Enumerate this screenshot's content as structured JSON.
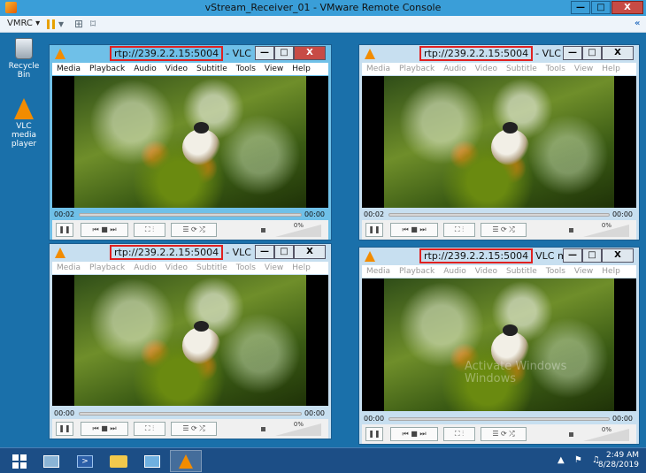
{
  "window": {
    "title": "vStream_Receiver_01 - VMware Remote Console",
    "min": "—",
    "max": "□",
    "close": "X"
  },
  "toolbar": {
    "menu": "VMRC ▾",
    "collapse": "«"
  },
  "desktop_icons": [
    {
      "label": "Recycle Bin"
    },
    {
      "label": "VLC media player"
    }
  ],
  "vlc_windows": [
    {
      "stream": "rtp://239.2.2.15:5004",
      "suffix": "- VLC media player",
      "time_start": "00:02",
      "time_end": "00:00",
      "volume": "0%"
    },
    {
      "stream": "rtp://239.2.2.15:5004",
      "suffix": "- VLC media player",
      "time_start": "00:02",
      "time_end": "00:00",
      "volume": "0%"
    },
    {
      "stream": "rtp://239.2.2.15:5004",
      "suffix": "- VLC media player",
      "time_start": "00:00",
      "time_end": "00:00",
      "volume": "0%"
    },
    {
      "stream": "rtp://239.2.2.15:5004",
      "suffix": "VLC media player",
      "time_start": "00:00",
      "time_end": "00:00",
      "volume": "0%"
    }
  ],
  "vlc_menu": [
    "Media",
    "Playback",
    "Audio",
    "Video",
    "Subtitle",
    "Tools",
    "View",
    "Help"
  ],
  "vlc_buttons": {
    "min": "—",
    "max": "□",
    "close": "X"
  },
  "watermark": {
    "line1": "Activate Windows",
    "line2": "Windows"
  },
  "taskbar": {
    "time": "2:49 AM",
    "date": "8/28/2019",
    "tray": "▲ ⚑ ♫"
  }
}
